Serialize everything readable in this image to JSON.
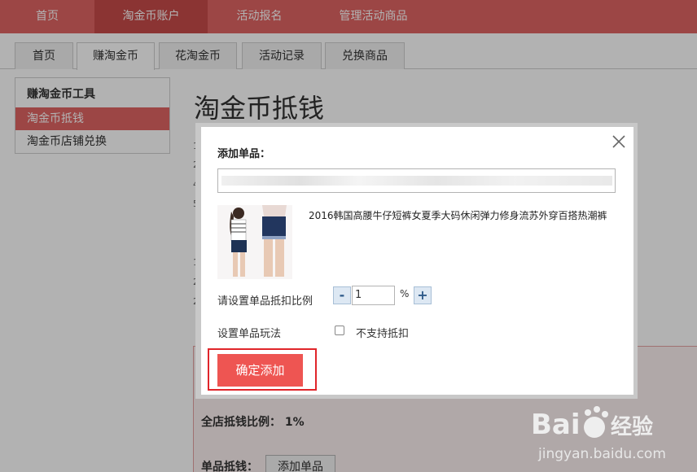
{
  "topnav": {
    "items": [
      {
        "label": "首页"
      },
      {
        "label": "淘金币账户"
      },
      {
        "label": "活动报名"
      },
      {
        "label": "管理活动商品"
      }
    ],
    "active_index": 1,
    "active_color": "#c84b49",
    "bar_color": "#e06563"
  },
  "subtabs": {
    "items": [
      {
        "label": "首页"
      },
      {
        "label": "赚淘金币"
      },
      {
        "label": "花淘金币"
      },
      {
        "label": "活动记录"
      },
      {
        "label": "兑换商品"
      }
    ],
    "active_index": 1
  },
  "sidebar": {
    "title": "赚淘金币工具",
    "items": [
      {
        "label": "淘金币抵钱",
        "active": true
      },
      {
        "label": "淘金币店铺兑换",
        "active": false
      }
    ]
  },
  "main": {
    "title": "淘金币抵钱",
    "step_numbers": [
      "1",
      "2",
      "4",
      "5",
      "1",
      "2",
      "2"
    ],
    "shop_ratio_text": "全店抵钱比例：  1%",
    "single_label": "单品抵钱：",
    "add_item_button": "添加单品"
  },
  "modal": {
    "title": "添加单品：",
    "input_value": "",
    "product_name": "2016韩国高腰牛仔短裤女夏季大码休闲弹力修身流苏外穿百搭热潮裤",
    "ratio_label": "请设置单品抵扣比例",
    "ratio_value": "1",
    "ratio_unit": "%",
    "minus_label": "-",
    "plus_label": "+",
    "play_label": "设置单品玩法",
    "checkbox_label": "不支持抵扣",
    "checkbox_checked": false,
    "confirm_button": "确定添加",
    "confirm_color": "#ee5552"
  },
  "watermark": {
    "brand": "Bai du 经验",
    "url": "jingyan.baidu.com"
  }
}
